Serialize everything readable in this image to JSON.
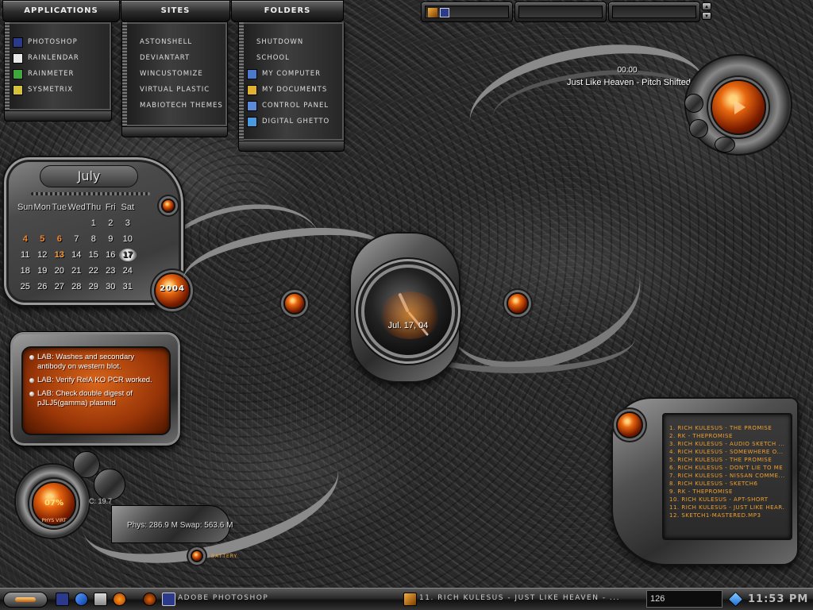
{
  "menus": {
    "applications": {
      "label": "Applications",
      "items": [
        {
          "label": "Photoshop",
          "icon": "photoshop-icon",
          "color": "#2b3a8a"
        },
        {
          "label": "Rainlendar",
          "icon": "calendar-icon",
          "color": "#e8e8e8"
        },
        {
          "label": "Rainmeter",
          "icon": "rainmeter-icon",
          "color": "#3fa83a"
        },
        {
          "label": "Sysmetrix",
          "icon": "sysmetrix-icon",
          "color": "#d6c23a"
        }
      ]
    },
    "sites": {
      "label": "Sites",
      "items": [
        {
          "label": "Astonshell"
        },
        {
          "label": "Deviantart"
        },
        {
          "label": "Wincustomize"
        },
        {
          "label": "Virtual Plastic"
        },
        {
          "label": "Mabiotech Themes"
        }
      ]
    },
    "folders": {
      "label": "Folders",
      "items": [
        {
          "label": "Shutdown",
          "icon": "none",
          "color": ""
        },
        {
          "label": "School",
          "icon": "none",
          "color": ""
        },
        {
          "label": "My Computer",
          "icon": "computer-icon",
          "color": "#4a7ad0"
        },
        {
          "label": "My Documents",
          "icon": "folder-icon",
          "color": "#e0b030"
        },
        {
          "label": "Control Panel",
          "icon": "control-panel-icon",
          "color": "#5a8ad8"
        },
        {
          "label": "Digital Ghetto",
          "icon": "network-icon",
          "color": "#4a9ae0"
        }
      ]
    }
  },
  "calendar": {
    "month": "July",
    "year": "2004",
    "weekdays": [
      "Sun",
      "Mon",
      "Tue",
      "Wed",
      "Thu",
      "Fri",
      "Sat"
    ],
    "weeks": [
      [
        "",
        "",
        "",
        "",
        "1",
        "2",
        "3"
      ],
      [
        "4",
        "5",
        "6",
        "7",
        "8",
        "9",
        "10"
      ],
      [
        "11",
        "12",
        "13",
        "14",
        "15",
        "16",
        "17"
      ],
      [
        "18",
        "19",
        "20",
        "21",
        "22",
        "23",
        "24"
      ],
      [
        "25",
        "26",
        "27",
        "28",
        "29",
        "30",
        "31"
      ]
    ],
    "highlighted": [
      "4",
      "5",
      "6"
    ],
    "event_day": "13",
    "today": "17"
  },
  "notes": [
    "LAB:  Washes and secondary antibody on western blot.",
    "LAB:  Verify RelA KO PCR worked.",
    "LAB: Check double digest of pJLJ5(gamma) plasmid"
  ],
  "clock": {
    "date": "Jul. 17, 04"
  },
  "player": {
    "time": "00:00",
    "title": "Just Like Heaven - Pitch Shifted"
  },
  "playlist": [
    "1. Rich Kulesus - The Promise",
    "2. RK - ThePromise",
    "3. Rich Kulesus - Audio Sketch ...",
    "4. Rich Kulesus - Somewhere O...",
    "5. Rich Kulesus - The Promise",
    "6. Rich Kulesus - Don't Lie To Me",
    "7. Rich Kulesus - Nissan Comme...",
    "8. Rich Kulesus - Sketch6",
    "9. RK - ThePromise",
    "10. Rich Kulesus - Apt-Short",
    "11. Rich Kulesus - Just Like Hear...",
    "12. Sketch1-mastered.mp3"
  ],
  "system": {
    "cpu": "07%",
    "phys_label": "PHYS VIRT",
    "memory": "Phys: 286.9 M  Swap: 563.6 M",
    "c_label": "C: 19.7",
    "battery": "BATTERY"
  },
  "taskbar": {
    "active_window": "Adobe Photoshop",
    "now_playing": "11. Rich Kulesus - Just Like Heaven - ...",
    "input_value": "126",
    "clock": "11:53 PM"
  },
  "colors": {
    "accent_orange": "#e8670f",
    "playlist_text": "#f0a030",
    "metal_light": "#9a9a9a",
    "metal_dark": "#2a2a2a"
  }
}
